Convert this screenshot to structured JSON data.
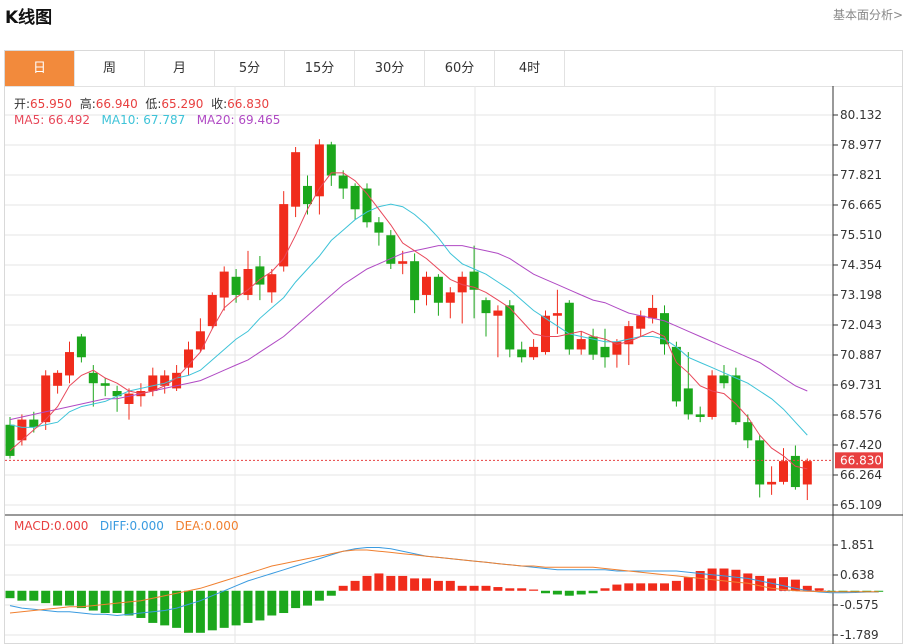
{
  "header": {
    "title": "K线图",
    "analysis_link": "基本面分析>"
  },
  "tabs": [
    {
      "label": "日",
      "active": true
    },
    {
      "label": "周",
      "active": false
    },
    {
      "label": "月",
      "active": false
    },
    {
      "label": "5分",
      "active": false
    },
    {
      "label": "15分",
      "active": false
    },
    {
      "label": "30分",
      "active": false
    },
    {
      "label": "60分",
      "active": false
    },
    {
      "label": "4时",
      "active": false
    }
  ],
  "ohlc_info": {
    "open_label": "开:",
    "open": "65.950",
    "high_label": "高:",
    "high": "66.940",
    "low_label": "低:",
    "low": "65.290",
    "close_label": "收:",
    "close": "66.830"
  },
  "ma_info": {
    "ma5_label": "MA5:",
    "ma5": "66.492",
    "ma10_label": "MA10:",
    "ma10": "67.787",
    "ma20_label": "MA20:",
    "ma20": "69.465"
  },
  "macd_info": {
    "macd_label": "MACD:",
    "macd": "0.000",
    "diff_label": "DIFF:",
    "diff": "0.000",
    "dea_label": "DEA:",
    "dea": "0.000"
  },
  "colors": {
    "up": "#f02c1c",
    "down": "#1ca71c",
    "ma5": "#e8485a",
    "ma10": "#3ec3d8",
    "ma20": "#b04ac4",
    "diff": "#3a9be0",
    "dea": "#f08030",
    "grid": "#e6e6e6",
    "current": "#e84040"
  },
  "chart_data": [
    {
      "type": "candlestick",
      "y_ticks": [
        "80.132",
        "78.977",
        "77.821",
        "76.665",
        "75.510",
        "74.354",
        "73.198",
        "72.043",
        "70.887",
        "69.731",
        "68.576",
        "67.420",
        "66.264",
        "65.109"
      ],
      "ylim": [
        65.109,
        80.132
      ],
      "current_price": "66.830",
      "candles": [
        [
          68.2,
          67.0,
          68.5,
          66.9
        ],
        [
          67.6,
          68.4,
          68.6,
          67.4
        ],
        [
          68.4,
          68.1,
          68.7,
          67.9
        ],
        [
          68.3,
          70.1,
          70.3,
          68.0
        ],
        [
          69.7,
          70.2,
          70.3,
          69.4
        ],
        [
          70.1,
          71.0,
          71.4,
          69.8
        ],
        [
          71.6,
          70.8,
          71.7,
          70.6
        ],
        [
          70.2,
          69.8,
          70.5,
          68.9
        ],
        [
          69.8,
          69.7,
          70.0,
          69.3
        ],
        [
          69.5,
          69.3,
          69.7,
          68.7
        ],
        [
          69.0,
          69.4,
          69.6,
          68.4
        ],
        [
          69.3,
          69.5,
          69.8,
          68.9
        ],
        [
          69.5,
          70.1,
          70.4,
          69.3
        ],
        [
          69.7,
          70.1,
          70.3,
          69.4
        ],
        [
          69.6,
          70.2,
          70.5,
          69.5
        ],
        [
          70.4,
          71.1,
          71.4,
          70.1
        ],
        [
          71.1,
          71.8,
          72.3,
          71.0
        ],
        [
          72.0,
          73.2,
          73.3,
          71.9
        ],
        [
          73.1,
          74.1,
          74.3,
          72.6
        ],
        [
          73.9,
          73.2,
          74.2,
          72.9
        ],
        [
          73.2,
          74.2,
          74.9,
          73.0
        ],
        [
          74.3,
          73.6,
          74.7,
          73.0
        ],
        [
          73.3,
          74.0,
          74.2,
          72.9
        ],
        [
          74.3,
          76.7,
          77.2,
          74.1
        ],
        [
          76.6,
          78.7,
          78.9,
          76.2
        ],
        [
          77.4,
          76.7,
          77.8,
          76.3
        ],
        [
          77.0,
          79.0,
          79.2,
          76.3
        ],
        [
          79.0,
          77.8,
          79.1,
          77.4
        ],
        [
          77.8,
          77.3,
          78.0,
          76.9
        ],
        [
          77.4,
          76.5,
          77.5,
          76.1
        ],
        [
          77.3,
          76.0,
          77.5,
          75.8
        ],
        [
          76.0,
          75.6,
          76.2,
          75.1
        ],
        [
          75.5,
          74.4,
          75.7,
          74.2
        ],
        [
          74.4,
          74.5,
          74.9,
          74.0
        ],
        [
          74.5,
          73.0,
          74.8,
          72.5
        ],
        [
          73.2,
          73.9,
          74.1,
          72.8
        ],
        [
          73.9,
          72.9,
          74.0,
          72.4
        ],
        [
          72.9,
          73.3,
          73.5,
          72.3
        ],
        [
          73.3,
          73.9,
          74.1,
          72.1
        ],
        [
          74.1,
          73.4,
          75.1,
          72.3
        ],
        [
          73.0,
          72.5,
          73.1,
          71.6
        ],
        [
          72.4,
          72.6,
          72.8,
          70.8
        ],
        [
          72.8,
          71.1,
          73.0,
          70.8
        ],
        [
          71.1,
          70.8,
          71.4,
          70.6
        ],
        [
          70.8,
          71.2,
          71.5,
          70.7
        ],
        [
          71.0,
          72.4,
          72.6,
          70.9
        ],
        [
          72.4,
          72.5,
          73.4,
          71.7
        ],
        [
          72.9,
          71.1,
          73.0,
          70.9
        ],
        [
          71.1,
          71.5,
          71.8,
          70.9
        ],
        [
          71.6,
          70.9,
          71.9,
          70.7
        ],
        [
          71.2,
          70.8,
          71.9,
          70.4
        ],
        [
          70.9,
          71.4,
          71.5,
          70.4
        ],
        [
          71.3,
          72.0,
          72.2,
          70.5
        ],
        [
          71.9,
          72.4,
          72.6,
          71.6
        ],
        [
          72.3,
          72.7,
          73.2,
          72.1
        ],
        [
          72.5,
          71.3,
          72.8,
          70.9
        ],
        [
          71.2,
          69.1,
          71.4,
          68.9
        ],
        [
          69.6,
          68.6,
          71.0,
          68.4
        ],
        [
          68.6,
          68.5,
          68.9,
          68.3
        ],
        [
          68.5,
          70.1,
          70.3,
          68.4
        ],
        [
          70.1,
          69.8,
          70.5,
          69.6
        ],
        [
          70.1,
          68.3,
          70.4,
          68.2
        ],
        [
          68.3,
          67.6,
          68.6,
          67.3
        ],
        [
          67.6,
          65.9,
          67.8,
          65.4
        ],
        [
          65.9,
          66.0,
          66.6,
          65.5
        ],
        [
          66.0,
          66.8,
          67.3,
          65.9
        ],
        [
          67.0,
          65.8,
          67.4,
          65.7
        ],
        [
          65.9,
          66.8,
          66.9,
          65.3
        ]
      ],
      "ma5": [
        67.2,
        67.6,
        68.0,
        68.4,
        68.9,
        69.7,
        70.1,
        70.3,
        70.0,
        69.8,
        69.5,
        69.4,
        69.5,
        69.7,
        70.0,
        70.5,
        71.0,
        71.9,
        72.7,
        73.1,
        73.4,
        73.8,
        74.1,
        74.6,
        75.5,
        76.5,
        77.3,
        77.9,
        77.9,
        77.6,
        77.1,
        76.5,
        75.9,
        75.2,
        74.9,
        74.6,
        74.2,
        73.8,
        73.6,
        73.5,
        73.3,
        73.0,
        72.7,
        72.2,
        71.7,
        71.6,
        71.6,
        71.7,
        71.8,
        71.6,
        71.5,
        71.3,
        71.4,
        71.6,
        71.8,
        71.6,
        70.6,
        70.2,
        69.7,
        69.5,
        69.4,
        69.0,
        68.5,
        67.8,
        67.3,
        67.0,
        66.6,
        66.5
      ],
      "ma10": [
        68.2,
        68.1,
        68.1,
        68.2,
        68.3,
        68.7,
        68.9,
        69.0,
        69.1,
        69.3,
        69.5,
        69.6,
        69.7,
        69.8,
        70.0,
        70.1,
        70.3,
        70.7,
        71.1,
        71.5,
        71.8,
        72.3,
        72.7,
        73.1,
        73.7,
        74.2,
        74.7,
        75.3,
        75.7,
        76.1,
        76.4,
        76.6,
        76.7,
        76.6,
        76.3,
        75.9,
        75.4,
        74.8,
        74.4,
        74.2,
        74.0,
        73.7,
        73.4,
        73.0,
        72.6,
        72.3,
        72.0,
        71.7,
        71.6,
        71.5,
        71.4,
        71.4,
        71.5,
        71.6,
        71.6,
        71.5,
        71.2,
        70.8,
        70.6,
        70.4,
        70.2,
        70.0,
        69.8,
        69.5,
        69.2,
        68.8,
        68.3,
        67.8
      ],
      "ma20": [
        68.4,
        68.5,
        68.6,
        68.7,
        68.8,
        68.9,
        69.0,
        69.1,
        69.2,
        69.2,
        69.3,
        69.4,
        69.5,
        69.6,
        69.7,
        69.8,
        69.9,
        70.1,
        70.3,
        70.5,
        70.7,
        71.0,
        71.3,
        71.6,
        72.0,
        72.4,
        72.8,
        73.2,
        73.6,
        73.9,
        74.2,
        74.4,
        74.6,
        74.8,
        74.9,
        75.0,
        75.1,
        75.1,
        75.1,
        75.0,
        74.9,
        74.8,
        74.6,
        74.3,
        74.0,
        73.8,
        73.6,
        73.4,
        73.2,
        73.0,
        72.9,
        72.7,
        72.5,
        72.4,
        72.3,
        72.2,
        72.0,
        71.8,
        71.6,
        71.4,
        71.2,
        71.0,
        70.8,
        70.6,
        70.3,
        70.0,
        69.7,
        69.5
      ]
    },
    {
      "type": "bar",
      "name": "MACD",
      "y_ticks": [
        "1.851",
        "0.638",
        "-0.575",
        "-1.789"
      ],
      "ylim": [
        -1.789,
        1.851
      ],
      "macd": [
        -0.3,
        -0.4,
        -0.4,
        -0.5,
        -0.6,
        -0.6,
        -0.7,
        -0.8,
        -0.9,
        -0.9,
        -1.0,
        -1.1,
        -1.3,
        -1.4,
        -1.5,
        -1.7,
        -1.7,
        -1.6,
        -1.5,
        -1.4,
        -1.3,
        -1.2,
        -1.0,
        -0.9,
        -0.7,
        -0.6,
        -0.4,
        -0.2,
        0.2,
        0.4,
        0.6,
        0.7,
        0.6,
        0.6,
        0.5,
        0.5,
        0.4,
        0.4,
        0.2,
        0.2,
        0.2,
        0.15,
        0.1,
        0.1,
        0.05,
        -0.1,
        -0.15,
        -0.2,
        -0.15,
        -0.1,
        0.1,
        0.25,
        0.3,
        0.3,
        0.3,
        0.3,
        0.4,
        0.55,
        0.8,
        0.9,
        0.9,
        0.85,
        0.7,
        0.6,
        0.5,
        0.55,
        0.45,
        0.2,
        0.1,
        -0.02,
        -0.02,
        -0.02,
        -0.04,
        -0.03
      ],
      "diff": [
        -0.6,
        -0.7,
        -0.75,
        -0.8,
        -0.85,
        -0.85,
        -0.9,
        -0.95,
        -0.95,
        -1.0,
        -0.95,
        -0.9,
        -0.85,
        -0.8,
        -0.7,
        -0.55,
        -0.4,
        -0.2,
        0.0,
        0.2,
        0.4,
        0.55,
        0.7,
        0.85,
        1.0,
        1.15,
        1.3,
        1.45,
        1.6,
        1.7,
        1.75,
        1.75,
        1.7,
        1.6,
        1.5,
        1.4,
        1.35,
        1.3,
        1.25,
        1.2,
        1.15,
        1.1,
        1.05,
        1.0,
        0.95,
        0.9,
        0.85,
        0.85,
        0.85,
        0.85,
        0.85,
        0.8,
        0.8,
        0.8,
        0.8,
        0.8,
        0.8,
        0.75,
        0.7,
        0.65,
        0.6,
        0.55,
        0.5,
        0.4,
        0.3,
        0.2,
        0.1,
        0.0,
        -0.05,
        -0.08,
        -0.08,
        -0.07,
        -0.05,
        -0.05
      ],
      "dea": [
        -0.9,
        -0.85,
        -0.8,
        -0.75,
        -0.7,
        -0.65,
        -0.65,
        -0.6,
        -0.55,
        -0.5,
        -0.45,
        -0.4,
        -0.3,
        -0.2,
        -0.1,
        0.0,
        0.1,
        0.25,
        0.4,
        0.55,
        0.7,
        0.85,
        1.0,
        1.1,
        1.2,
        1.3,
        1.4,
        1.5,
        1.6,
        1.65,
        1.65,
        1.6,
        1.55,
        1.5,
        1.45,
        1.4,
        1.35,
        1.3,
        1.25,
        1.2,
        1.15,
        1.1,
        1.05,
        1.0,
        1.0,
        0.95,
        0.95,
        0.95,
        0.95,
        0.95,
        0.9,
        0.85,
        0.8,
        0.75,
        0.7,
        0.65,
        0.6,
        0.55,
        0.5,
        0.45,
        0.4,
        0.35,
        0.3,
        0.2,
        0.1,
        0.05,
        0.0,
        -0.02,
        -0.03,
        -0.04,
        -0.04,
        -0.04,
        -0.04,
        -0.04
      ]
    }
  ]
}
